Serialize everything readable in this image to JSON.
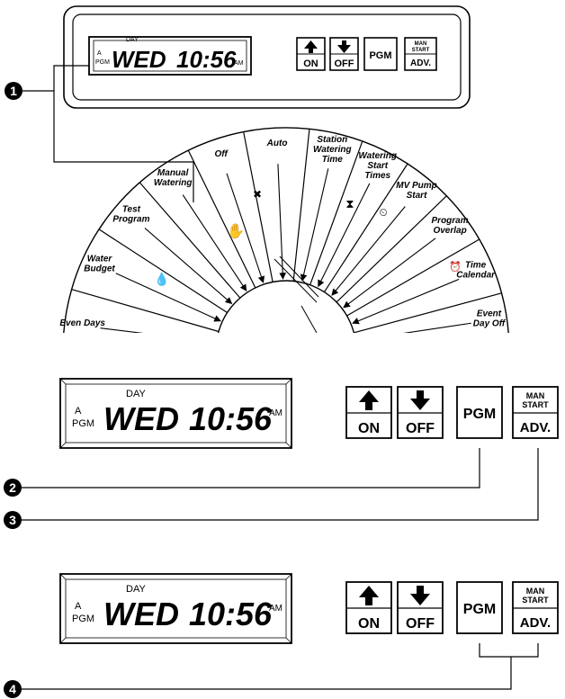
{
  "display": {
    "day_label": "DAY",
    "prog_a": "A",
    "prog_pgm": "PGM",
    "day": "WED",
    "time": "10:56",
    "ampm": "AM"
  },
  "buttons": {
    "on": "ON",
    "off": "OFF",
    "pgm": "PGM",
    "man_start_line1": "MAN",
    "man_start_line2": "START",
    "adv": "ADV."
  },
  "dial": {
    "positions": [
      {
        "line1": "Even  Days",
        "line2": ""
      },
      {
        "line1": "Water",
        "line2": "Budget"
      },
      {
        "line1": "Test",
        "line2": "Program"
      },
      {
        "line1": "Manual",
        "line2": "Watering"
      },
      {
        "line1": "Off",
        "line2": ""
      },
      {
        "line1": "Auto",
        "line2": ""
      },
      {
        "line1": "Station",
        "line2": "Watering",
        "line3": "Time"
      },
      {
        "line1": "Watering",
        "line2": "Start",
        "line3": "Times"
      },
      {
        "line1": "MV Pump",
        "line2": "Start"
      },
      {
        "line1": "Program",
        "line2": "Overlap"
      },
      {
        "line1": "Time",
        "line2": "Calendar"
      },
      {
        "line1": "Event",
        "line2": "Day Off"
      }
    ]
  },
  "callouts": [
    "1",
    "2",
    "3",
    "4"
  ],
  "icons": [
    "up-arrow-icon",
    "down-arrow-icon",
    "hand-icon",
    "sprinkler-off-icon",
    "hourglass-icon",
    "clock-icon",
    "water-drop-percent-icon",
    "calendar-clock-icon"
  ]
}
